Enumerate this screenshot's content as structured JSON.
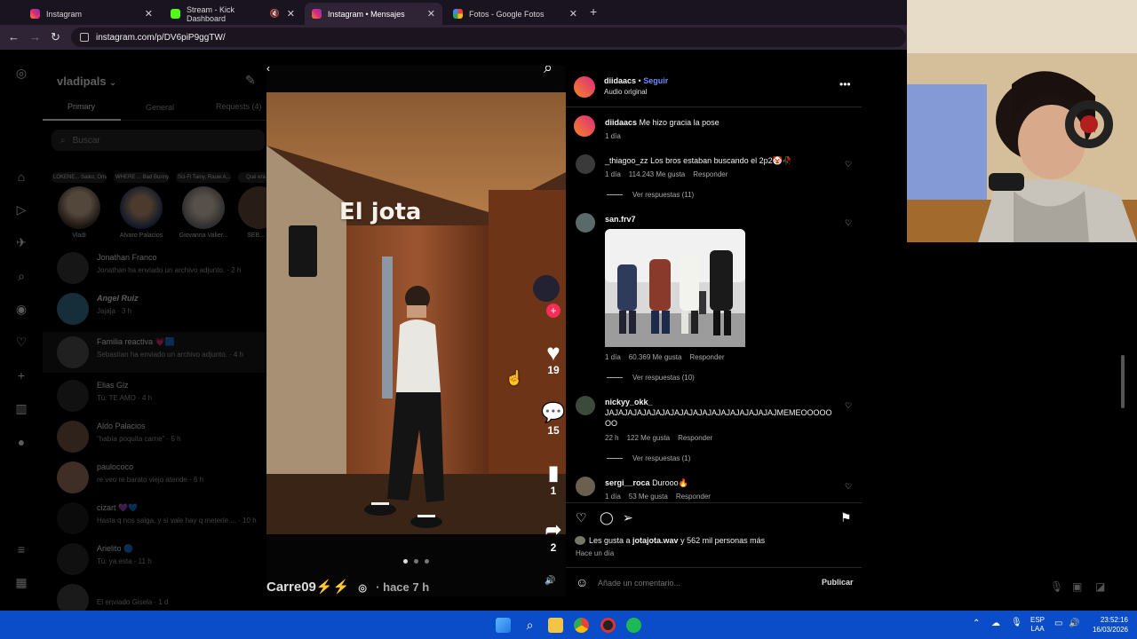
{
  "browser": {
    "tabs": [
      {
        "title": "Instagram",
        "color": "#e1306c"
      },
      {
        "title": "Stream - Kick Dashboard",
        "color": "#53fc18"
      },
      {
        "title": "Instagram • Mensajes",
        "color": "#e1306c"
      },
      {
        "title": "Fotos - Google Fotos",
        "color": "#fbbc04"
      }
    ],
    "url": "instagram.com/p/DV6piP9ggTW/"
  },
  "dm": {
    "account": "vladipals",
    "tabs": [
      "Primary",
      "General",
      "Requests (4)"
    ],
    "search_placeholder": "Buscar",
    "notes": [
      {
        "bubble": "LOKENE... Saiko, Omar C...",
        "name": "Vladi"
      },
      {
        "bubble": "WHERE ... Bad Bunny",
        "name": "Alvaro Palacios"
      },
      {
        "bubble": "Sci-Fi Tainy, Rauw A...",
        "name": "Giovanna Valier..."
      },
      {
        "bubble": "Qué era",
        "name": "SEB..."
      }
    ],
    "conversations": [
      {
        "name": "Jonathan Franco",
        "preview": "Jonathan ha enviado un archivo adjunto. · 2 h"
      },
      {
        "name": "Angel Ruiz",
        "preview": "Jajaja · 3 h"
      },
      {
        "name": "Familia reactiva 💗🟦",
        "preview": "Sebastian ha enviado un archivo adjunto. · 4 h"
      },
      {
        "name": "Elias Glz",
        "preview": "Tú: TE AMO · 4 h"
      },
      {
        "name": "Aldo Palacios",
        "preview": "\"había poquita carne\" · 5 h"
      },
      {
        "name": "paulococo",
        "preview": "re veo re barato viejo atende · 6 h"
      },
      {
        "name": "cizart 💜💙",
        "preview": "Hasta q nos salga, y si vale hay q meterle ... · 10 h"
      },
      {
        "name": "Arielito 🔵",
        "preview": "Tú: ya esta · 11 h"
      },
      {
        "name": "",
        "preview": "El enviado Gisela · 1 d"
      }
    ]
  },
  "video": {
    "overlay_text": "El jota",
    "likes": "19",
    "comments": "15",
    "saves": "1",
    "shares": "2",
    "caption": "Carre09⚡⚡",
    "time": "· hace 7 h"
  },
  "post": {
    "author": "diidaacs",
    "follow": "Seguir",
    "audio": "Audio original",
    "caption_user": "diidaacs",
    "caption_text": "Me hizo gracia la pose",
    "caption_time": "1 día",
    "comments": [
      {
        "user": "_thiagoo_zz",
        "text": "Los bros estaban buscando el 2p2🤡🥀",
        "time": "1 día",
        "likes": "114.243 Me gusta",
        "reply": "Responder",
        "replies": "Ver respuestas (11)"
      },
      {
        "user": "san.frv7",
        "text": "",
        "time": "1 día",
        "likes": "60.369 Me gusta",
        "reply": "Responder",
        "replies": "Ver respuestas (10)"
      },
      {
        "user": "nickyy_okk_",
        "text": "JAJAJAJAJAJAJAJAJAJAJAJAJAJAJAJAJAJAJMEMEOOOOOOO",
        "time": "22 h",
        "likes": "122 Me gusta",
        "reply": "Responder",
        "replies": "Ver respuestas (1)"
      },
      {
        "user": "sergi__roca",
        "text": "Durooo🔥",
        "time": "1 día",
        "likes": "53 Me gusta",
        "reply": "Responder",
        "replies": ""
      }
    ],
    "liked_by_prefix": "Les gusta a ",
    "liked_by_user": "jotajota.wav",
    "liked_by_suffix": " y 562 mil personas más",
    "posted": "Hace un día",
    "comment_placeholder": "Añade un comentario...",
    "publish": "Publicar"
  },
  "taskbar": {
    "lang_top": "ESP",
    "lang_bottom": "LAA",
    "time": "23:52:16",
    "date": "16/03/2026"
  }
}
